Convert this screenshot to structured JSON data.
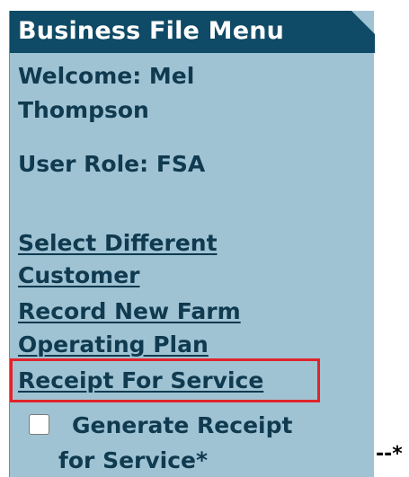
{
  "menu": {
    "title": "Business File Menu",
    "welcome_label": "Welcome: Mel",
    "welcome_name": "Thompson",
    "user_role": "User Role: FSA",
    "links": {
      "select_line1": "Select Different",
      "select_line2": "Customer",
      "record_line1": "Record New Farm",
      "record_line2": "Operating Plan",
      "receipt": "Receipt For Service"
    },
    "generate_receipt": {
      "line1": "Generate Receipt",
      "line2": "for Service*",
      "checked": false
    }
  },
  "trailing_marker": "--*",
  "colors": {
    "panel_bg": "#9fc3d3",
    "header_bg": "#0f4a66",
    "text": "#0f3a4f",
    "highlight": "#e0242b"
  }
}
